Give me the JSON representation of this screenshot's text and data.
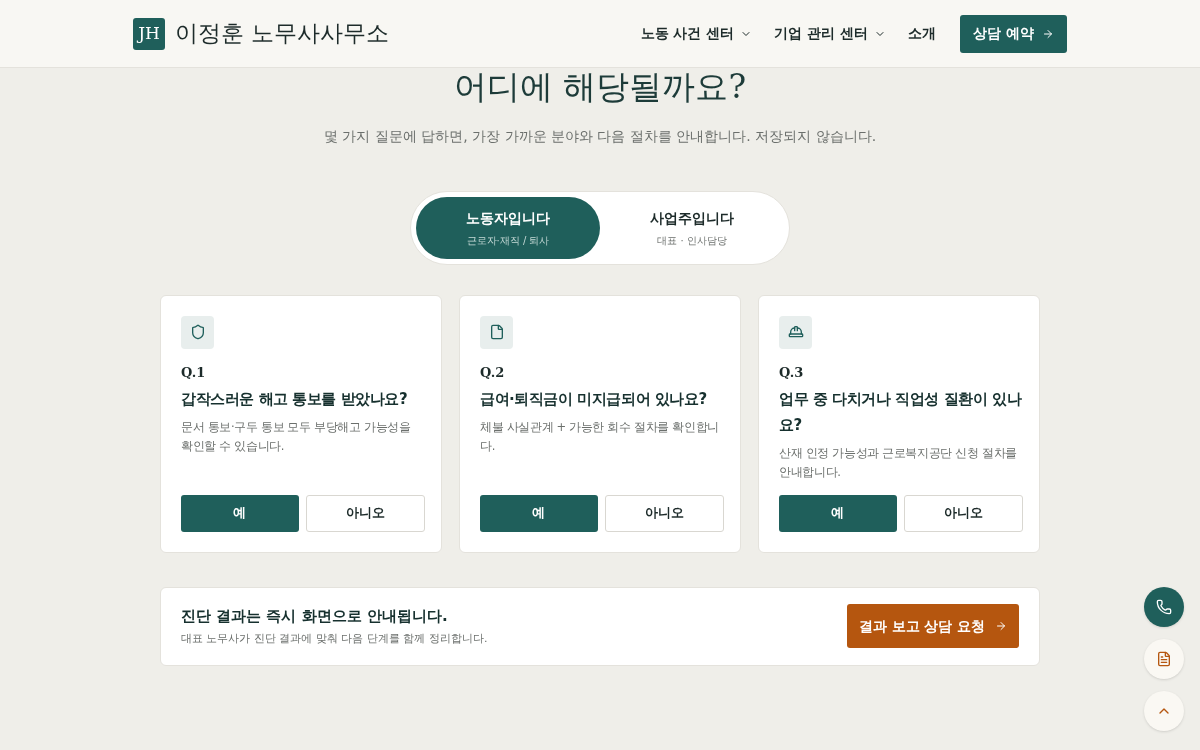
{
  "header": {
    "logo_mark": "JH",
    "logo_text": "이정훈 노무사사무소",
    "nav": [
      {
        "label": "노동 사건 센터",
        "dropdown": true
      },
      {
        "label": "기업 관리 센터",
        "dropdown": true
      },
      {
        "label": "소개",
        "dropdown": false
      }
    ],
    "cta": "상담 예약"
  },
  "heading": "어디에 해당될까요?",
  "subtitle": "몇 가지 질문에 답하면, 가장 가까운 분야와 다음 절차를 안내합니다. 저장되지 않습니다.",
  "audience_tabs": [
    {
      "label": "노동자입니다",
      "sub": "근로자·재직 / 퇴사",
      "selected": true
    },
    {
      "label": "사업주입니다",
      "sub": "대표 · 인사담당",
      "selected": false
    }
  ],
  "questions": [
    {
      "kind": "shield",
      "number": "Q.1",
      "title": "갑작스러운 해고 통보를 받았나요?",
      "description": "문서 통보·구두 통보 모두 부당해고 가능성을 확인할 수 있습니다.",
      "yes": "예",
      "no": "아니오"
    },
    {
      "kind": "document",
      "number": "Q.2",
      "title": "급여·퇴직금이 미지급되어 있나요?",
      "description": "체불 사실관계 + 가능한 회수 절차를 확인합니다.",
      "yes": "예",
      "no": "아니오"
    },
    {
      "kind": "helmet",
      "number": "Q.3",
      "title": "업무 중 다치거나 직업성 질환이 있나요?",
      "description": "산재 인정 가능성과 근로복지공단 신청 절차를 안내합니다.",
      "yes": "예",
      "no": "아니오"
    }
  ],
  "result_bar": {
    "title": "진단 결과는 즉시 화면으로 안내됩니다.",
    "description": "대표 노무사가 진단 결과에 맞춰 다음 단계를 함께 정리합니다.",
    "button": "결과 보고 상담 요청"
  }
}
